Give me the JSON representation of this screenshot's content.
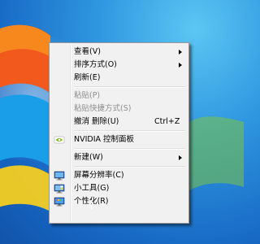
{
  "context_menu": {
    "items": [
      {
        "label": "查看(V)",
        "has_submenu": true
      },
      {
        "label": "排序方式(O)",
        "has_submenu": true
      },
      {
        "label": "刷新(E)"
      },
      {
        "label": "粘贴(P)",
        "disabled": true
      },
      {
        "label": "粘贴快捷方式(S)",
        "disabled": true
      },
      {
        "label": "撤消 删除(U)",
        "shortcut": "Ctrl+Z"
      },
      {
        "label": "NVIDIA 控制面板",
        "icon": "nvidia-icon"
      },
      {
        "label": "新建(W)",
        "has_submenu": true
      },
      {
        "label": "屏幕分辨率(C)",
        "icon": "screen-resolution-icon"
      },
      {
        "label": "小工具(G)",
        "icon": "gadgets-icon"
      },
      {
        "label": "个性化(R)",
        "icon": "personalize-icon"
      }
    ]
  },
  "colors": {
    "desktop_blue": "#1e7fd6",
    "menu_background": "#f1f1f1",
    "disabled_text": "#8d8d8d",
    "nvidia_green": "#76b900"
  }
}
